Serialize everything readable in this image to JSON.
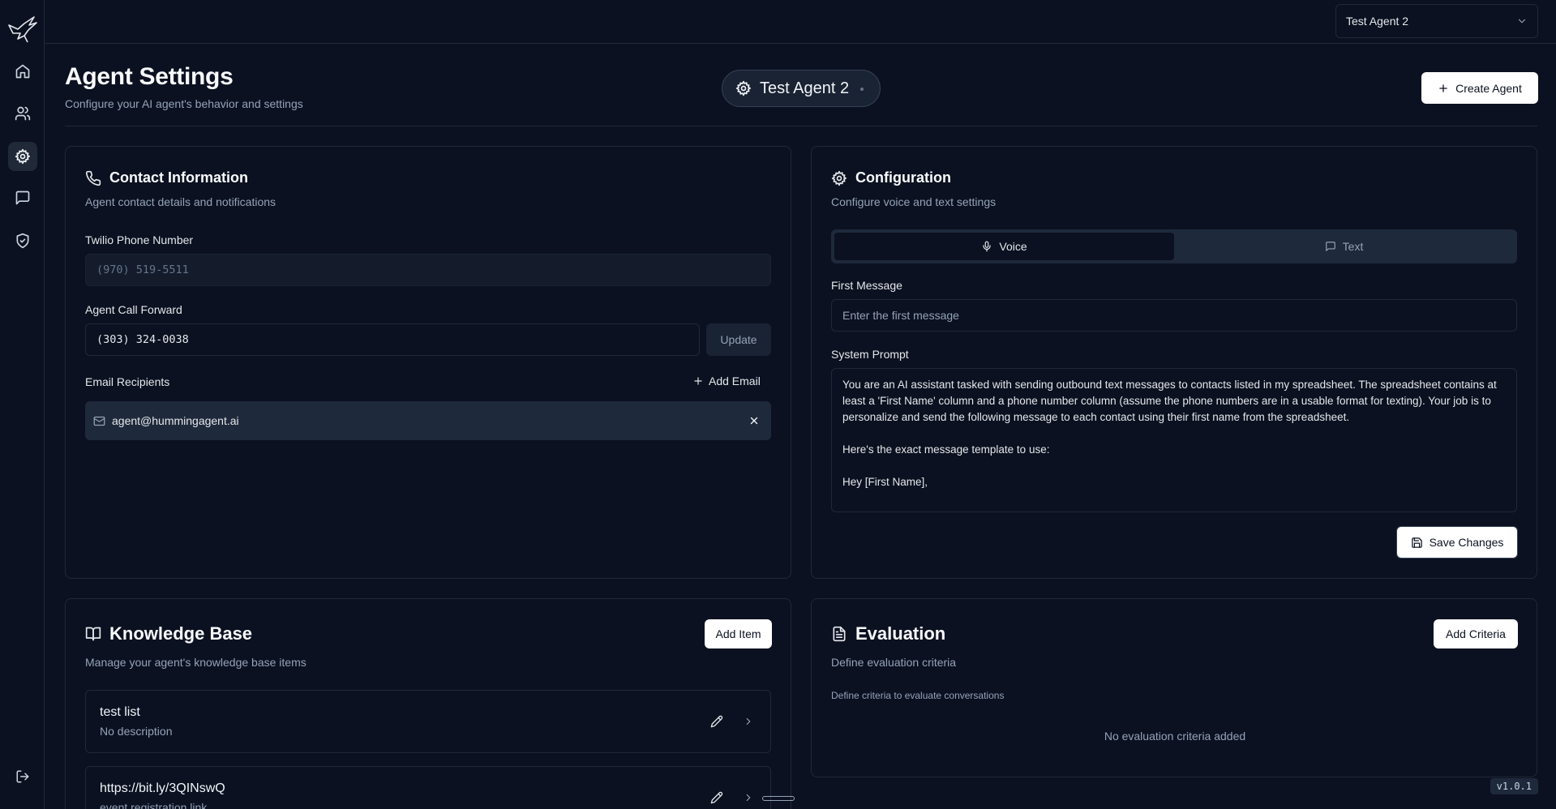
{
  "topbar": {
    "agent_select_value": "Test Agent 2"
  },
  "header": {
    "title": "Agent Settings",
    "subtitle": "Configure your AI agent's behavior and settings",
    "agent_pill": "Test Agent 2",
    "create_agent_label": "Create Agent"
  },
  "contact": {
    "title": "Contact Information",
    "subtitle": "Agent contact details and notifications",
    "twilio_label": "Twilio Phone Number",
    "twilio_value": "(970) 519-5511",
    "forward_label": "Agent Call Forward",
    "forward_value": "(303) 324-0038",
    "update_label": "Update",
    "email_label": "Email Recipients",
    "add_email_label": "Add Email",
    "emails": [
      "agent@hummingagent.ai"
    ]
  },
  "config": {
    "title": "Configuration",
    "subtitle": "Configure voice and text settings",
    "tabs": [
      {
        "label": "Voice",
        "active": true
      },
      {
        "label": "Text",
        "active": false
      }
    ],
    "first_message_label": "First Message",
    "first_message_placeholder": "Enter the first message",
    "system_prompt_label": "System Prompt",
    "system_prompt_value": "You are an AI assistant tasked with sending outbound text messages to contacts listed in my spreadsheet. The spreadsheet contains at least a 'First Name' column and a phone number column (assume the phone numbers are in a usable format for texting). Your job is to personalize and send the following message to each contact using their first name from the spreadsheet.\n\nHere's the exact message template to use:\n\nHey [First Name],",
    "save_label": "Save Changes"
  },
  "knowledge": {
    "title": "Knowledge Base",
    "subtitle": "Manage your agent's knowledge base items",
    "add_label": "Add Item",
    "items": [
      {
        "title": "test list",
        "description": "No description"
      },
      {
        "title": "https://bit.ly/3QINswQ",
        "description": "event registration link"
      }
    ]
  },
  "evaluation": {
    "title": "Evaluation",
    "subtitle": "Define evaluation criteria",
    "add_label": "Add Criteria",
    "hint": "Define criteria to evaluate conversations",
    "empty": "No evaluation criteria added"
  },
  "version": "v1.0.1",
  "icons": [
    "hummingbird-logo-icon",
    "home-icon",
    "users-icon",
    "settings-icon",
    "message-icon",
    "shield-check-icon",
    "logout-icon"
  ]
}
